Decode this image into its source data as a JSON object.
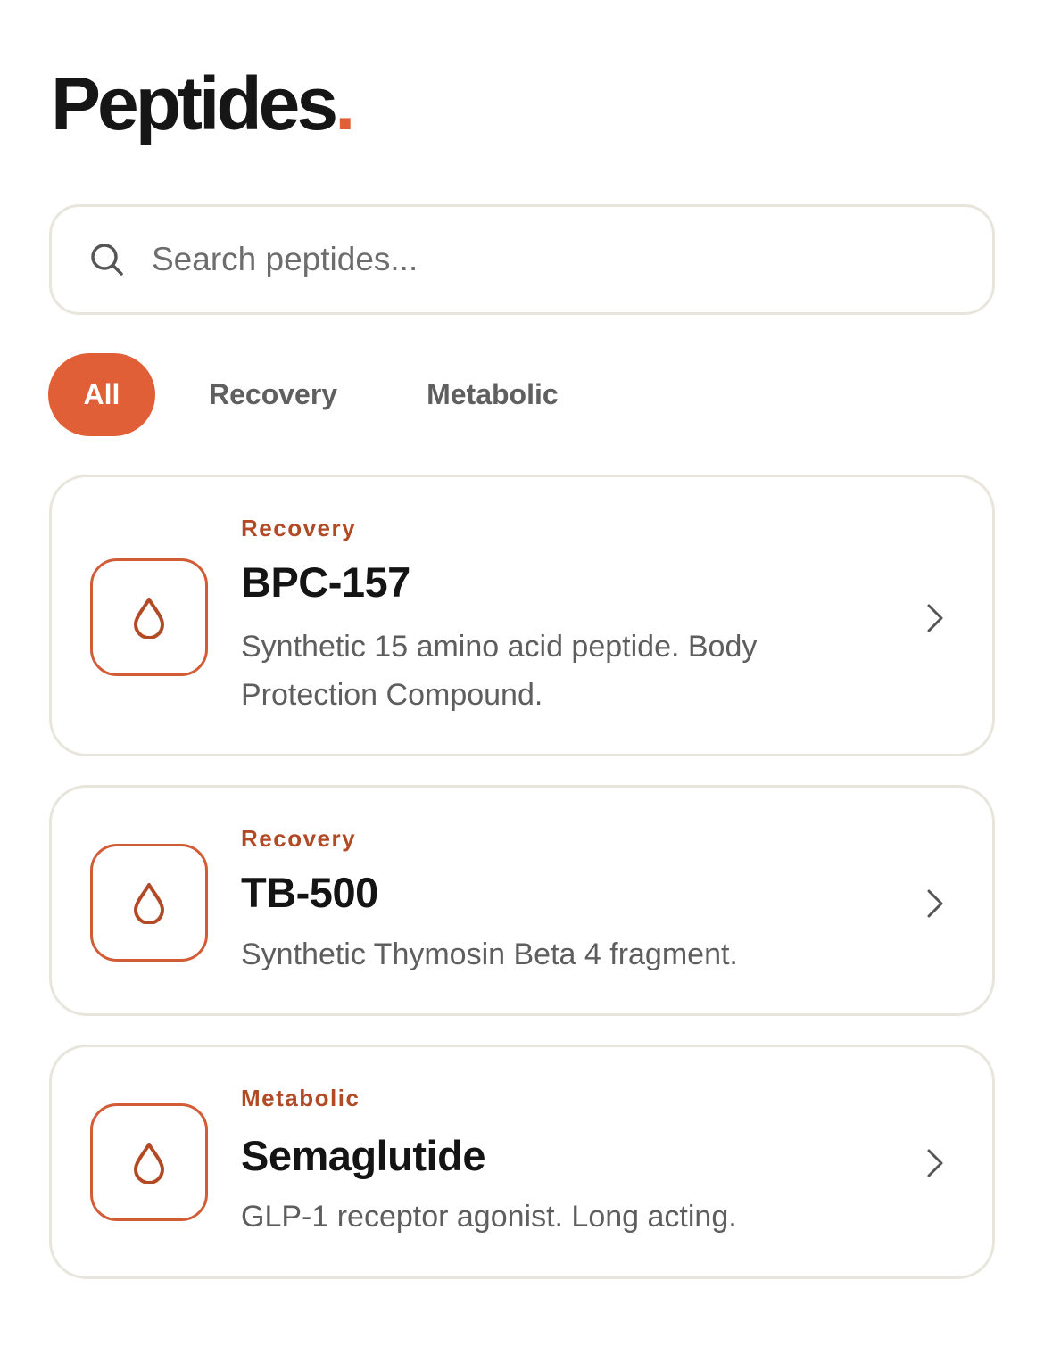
{
  "page": {
    "title": "Peptides",
    "title_dot": "."
  },
  "search": {
    "placeholder": "Search peptides...",
    "icon": "search-icon"
  },
  "filters": [
    {
      "label": "All",
      "active": true
    },
    {
      "label": "Recovery",
      "active": false
    },
    {
      "label": "Metabolic",
      "active": false
    }
  ],
  "peptides": [
    {
      "category": "Recovery",
      "name": "BPC-157",
      "description": "Synthetic 15 amino acid peptide. Body Protection Compound.",
      "icon": "drop-icon"
    },
    {
      "category": "Recovery",
      "name": "TB-500",
      "description": "Synthetic Thymosin Beta 4 fragment.",
      "icon": "drop-icon"
    },
    {
      "category": "Metabolic",
      "name": "Semaglutide",
      "description": "GLP-1 receptor agonist. Long acting.",
      "icon": "drop-icon"
    }
  ],
  "colors": {
    "accent": "#e15f36",
    "category_text": "#b24a26",
    "border": "#e8e6dc"
  }
}
